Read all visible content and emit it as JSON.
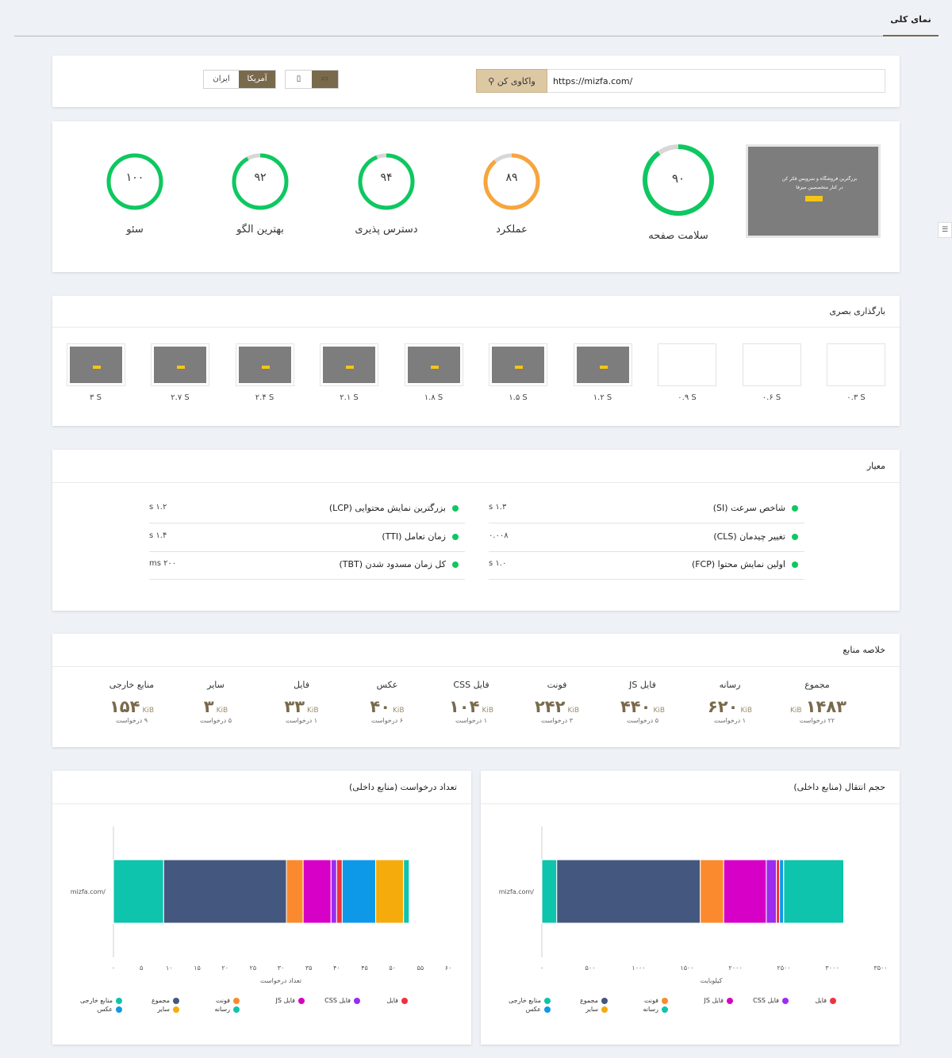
{
  "top_tab": "نمای کلی",
  "search": {
    "url_value": "https://mizfa.com/",
    "analyze_label": "واکاوی کن",
    "region_options": [
      "آمریکا",
      "ایران"
    ],
    "region_selected": "آمریکا",
    "device_selected": "desktop"
  },
  "scores": {
    "health": {
      "label": "سلامت صفحه",
      "value": "۹۰",
      "pct": 90
    },
    "items": [
      {
        "label": "عملکرد",
        "value": "۸۹",
        "pct": 89,
        "color": "#f7a53c"
      },
      {
        "label": "دسترس پذیری",
        "value": "۹۴",
        "pct": 94,
        "color": "#0dc860"
      },
      {
        "label": "بهترین الگو",
        "value": "۹۲",
        "pct": 92,
        "color": "#0dc860"
      },
      {
        "label": "سئو",
        "value": "۱۰۰",
        "pct": 100,
        "color": "#0dc860"
      }
    ],
    "thumb_line1": "بزرگترین فروشگاه و سرویس فکر کن",
    "thumb_line2": "در کنار متخصصین میزفا"
  },
  "filmstrip": {
    "title": "بارگذاری بصری",
    "frames": [
      {
        "time": "۰.۳ S",
        "loaded": false
      },
      {
        "time": "۰.۶ S",
        "loaded": false
      },
      {
        "time": "۰.۹ S",
        "loaded": false
      },
      {
        "time": "۱.۲ S",
        "loaded": true
      },
      {
        "time": "۱.۵ S",
        "loaded": true
      },
      {
        "time": "۱.۸ S",
        "loaded": true
      },
      {
        "time": "۲.۱ S",
        "loaded": true
      },
      {
        "time": "۲.۴ S",
        "loaded": true
      },
      {
        "time": "۲.۷ S",
        "loaded": true
      },
      {
        "time": "۳ S",
        "loaded": true
      }
    ]
  },
  "metrics": {
    "title": "معیار",
    "right": [
      {
        "name": "شاخص سرعت (SI)",
        "value": "۱.۳ s"
      },
      {
        "name": "تغییر چیدمان (CLS)",
        "value": "۰.۰۰۸"
      },
      {
        "name": "اولین نمایش محتوا (FCP)",
        "value": "۱.۰ s"
      }
    ],
    "left": [
      {
        "name": "بزرگترین نمایش محتوایی (LCP)",
        "value": "۱.۲ s"
      },
      {
        "name": "زمان تعامل (TTI)",
        "value": "۱.۴ s"
      },
      {
        "name": "کل زمان مسدود شدن (TBT)",
        "value": "۲۰۰ ms"
      }
    ]
  },
  "resources": {
    "title": "خلاصه منابع",
    "unit": "KiB",
    "items": [
      {
        "label": "مجموع",
        "size": "۱۴۸۳",
        "requests": "۲۲ درخواست"
      },
      {
        "label": "رسانه",
        "size": "۶۲۰",
        "requests": "۱ درخواست"
      },
      {
        "label": "فایل JS",
        "size": "۴۴۰",
        "requests": "۵ درخواست"
      },
      {
        "label": "فونت",
        "size": "۲۴۲",
        "requests": "۳ درخواست"
      },
      {
        "label": "فایل CSS",
        "size": "۱۰۴",
        "requests": "۱ درخواست"
      },
      {
        "label": "عکس",
        "size": "۴۰",
        "requests": "۶ درخواست"
      },
      {
        "label": "فایل",
        "size": "۳۳",
        "requests": "۱ درخواست"
      },
      {
        "label": "سایر",
        "size": "۳",
        "requests": "۵ درخواست"
      },
      {
        "label": "منابع خارجی",
        "size": "۱۵۴",
        "requests": "۹ درخواست"
      }
    ]
  },
  "legend": [
    {
      "label": "فایل",
      "color": "#f0313f"
    },
    {
      "label": "فایل CSS",
      "color": "#9b2cf0"
    },
    {
      "label": "فایل JS",
      "color": "#d600c6"
    },
    {
      "label": "فونت",
      "color": "#fb8a2e"
    },
    {
      "label": "رسانه",
      "color": "#0ec4ad"
    },
    {
      "label": "مجموع",
      "color": "#44577f"
    },
    {
      "label": "سایر",
      "color": "#f5ab0c"
    },
    {
      "label": "منابع خارجی",
      "color": "#0ec4ad"
    },
    {
      "label": "عکس",
      "color": "#0d99e8"
    }
  ],
  "chart_data": [
    {
      "type": "bar",
      "orientation": "horizontal",
      "stacked": true,
      "title": "حجم انتقال (منابع داخلی)",
      "categories": [
        "mizfa.com/"
      ],
      "xlabel": "کیلوبایت",
      "xlim": [
        0,
        3500
      ],
      "xticks": [
        "۰",
        "۵۰۰",
        "۱۰۰۰",
        "۱۵۰۰",
        "۲۰۰۰",
        "۲۵۰۰",
        "۳۰۰۰",
        "۳۵۰۰"
      ],
      "series": [
        {
          "name": "منابع خارجی",
          "values": [
            154
          ],
          "color": "#0ec4ad"
        },
        {
          "name": "مجموع",
          "values": [
            1483
          ],
          "color": "#44577f"
        },
        {
          "name": "فونت",
          "values": [
            242
          ],
          "color": "#fb8a2e"
        },
        {
          "name": "فایل JS",
          "values": [
            440
          ],
          "color": "#d600c6"
        },
        {
          "name": "فایل CSS",
          "values": [
            104
          ],
          "color": "#9b2cf0"
        },
        {
          "name": "فایل",
          "values": [
            33
          ],
          "color": "#f0313f"
        },
        {
          "name": "عکس",
          "values": [
            40
          ],
          "color": "#0d99e8"
        },
        {
          "name": "سایر",
          "values": [
            3
          ],
          "color": "#f5ab0c"
        },
        {
          "name": "رسانه",
          "values": [
            620
          ],
          "color": "#0ec4ad"
        }
      ]
    },
    {
      "type": "bar",
      "orientation": "horizontal",
      "stacked": true,
      "title": "تعداد درخواست (منابع داخلی)",
      "categories": [
        "mizfa.com/"
      ],
      "xlabel": "تعداد درخواست",
      "xlim": [
        0,
        60
      ],
      "xticks": [
        "۰",
        "۵",
        "۱۰",
        "۱۵",
        "۲۰",
        "۲۵",
        "۳۰",
        "۳۵",
        "۴۰",
        "۴۵",
        "۵۰",
        "۵۵",
        "۶۰"
      ],
      "series": [
        {
          "name": "منابع خارجی",
          "values": [
            9
          ],
          "color": "#0ec4ad"
        },
        {
          "name": "مجموع",
          "values": [
            22
          ],
          "color": "#44577f"
        },
        {
          "name": "فونت",
          "values": [
            3
          ],
          "color": "#fb8a2e"
        },
        {
          "name": "فایل JS",
          "values": [
            5
          ],
          "color": "#d600c6"
        },
        {
          "name": "فایل CSS",
          "values": [
            1
          ],
          "color": "#9b2cf0"
        },
        {
          "name": "فایل",
          "values": [
            1
          ],
          "color": "#f0313f"
        },
        {
          "name": "عکس",
          "values": [
            6
          ],
          "color": "#0d99e8"
        },
        {
          "name": "سایر",
          "values": [
            5
          ],
          "color": "#f5ab0c"
        },
        {
          "name": "رسانه",
          "values": [
            1
          ],
          "color": "#0ec4ad"
        }
      ]
    }
  ]
}
